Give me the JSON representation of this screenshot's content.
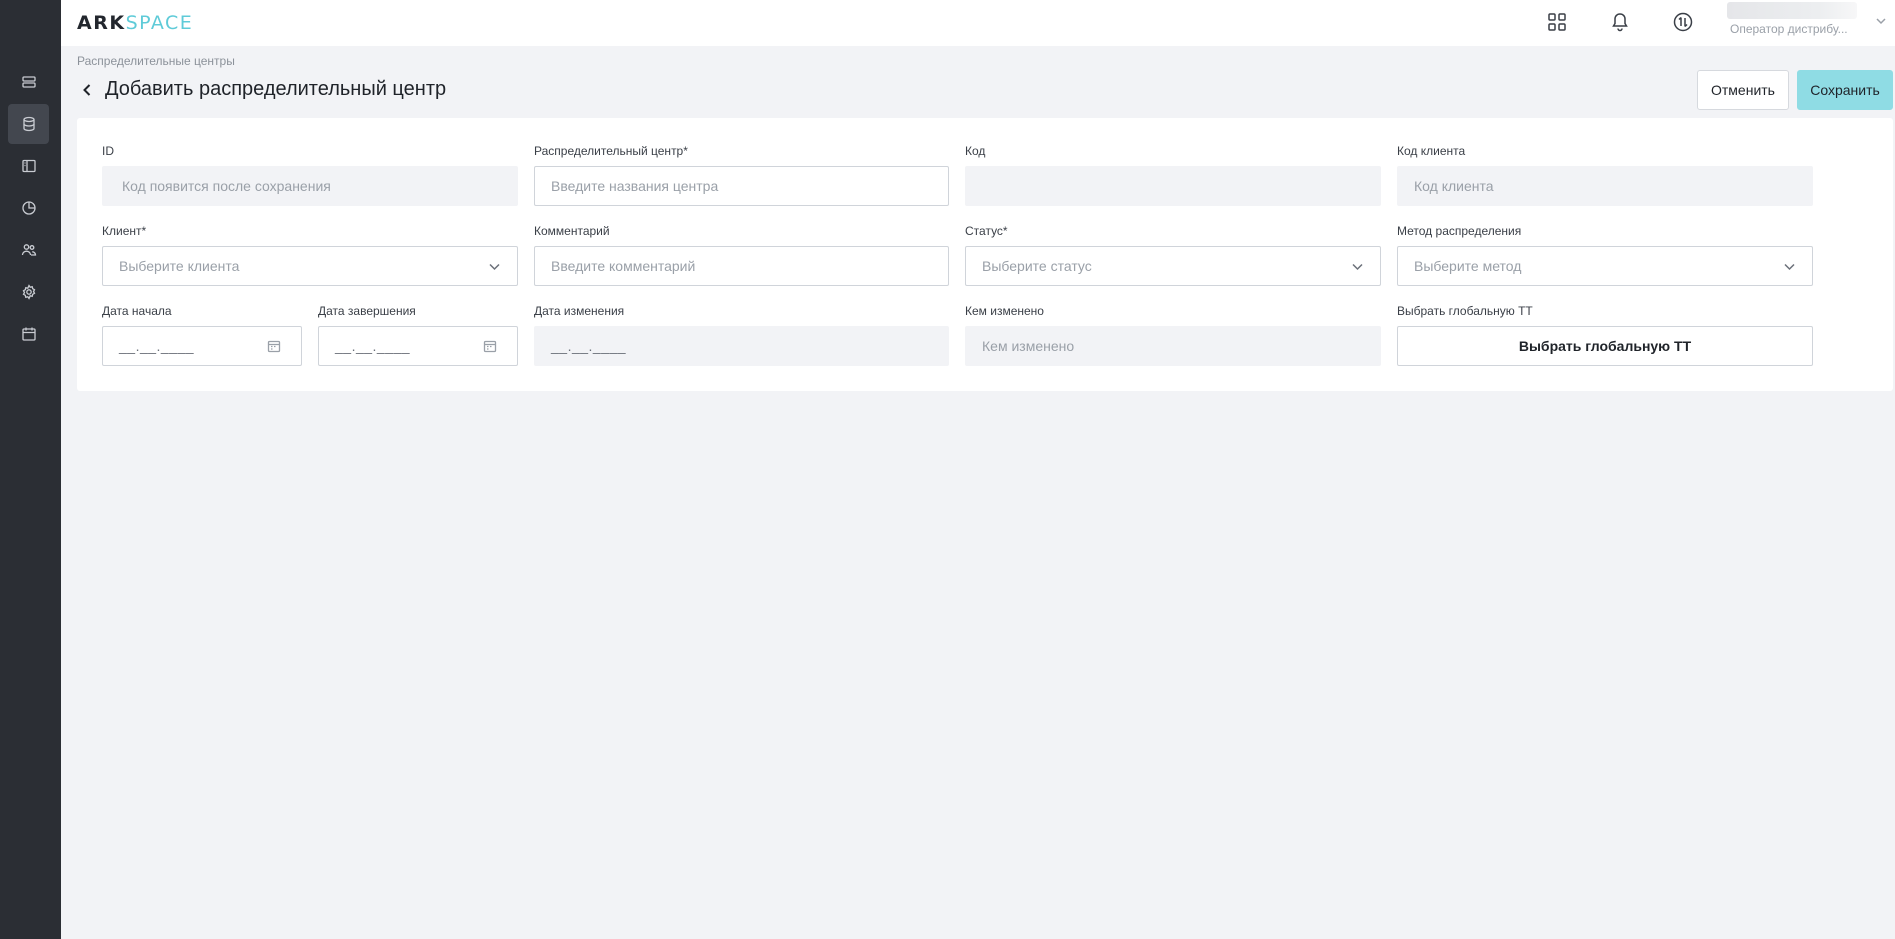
{
  "app": {
    "logo_ark": "ARK",
    "logo_space": "SPACE"
  },
  "user": {
    "role": "Оператор дистрибу..."
  },
  "breadcrumb": "Распределительные центры",
  "page_title": "Добавить распределительный центр",
  "actions": {
    "cancel_label": "Отменить",
    "save_label": "Сохранить"
  },
  "form": {
    "id": {
      "label": "ID",
      "placeholder": "Код появится после сохранения"
    },
    "center": {
      "label": "Распределительный центр*",
      "placeholder": "Введите названия центра"
    },
    "code": {
      "label": "Код",
      "value": ""
    },
    "client_code": {
      "label": "Код клиента",
      "placeholder": "Код клиента"
    },
    "client": {
      "label": "Клиент*",
      "placeholder": "Выберите клиента"
    },
    "comment": {
      "label": "Комментарий",
      "placeholder": "Введите комментарий"
    },
    "status": {
      "label": "Статус*",
      "placeholder": "Выберите статус"
    },
    "method": {
      "label": "Метод распределения",
      "placeholder": "Выберите метод"
    },
    "start_date": {
      "label": "Дата начала",
      "mask": "__.__.____"
    },
    "end_date": {
      "label": "Дата завершения",
      "mask": "__.__.____"
    },
    "modified_date": {
      "label": "Дата изменения",
      "mask": "__.__.____"
    },
    "modified_by": {
      "label": "Кем изменено",
      "placeholder": "Кем изменено"
    },
    "global_tt": {
      "label": "Выбрать глобальную ТТ",
      "button_label": "Выбрать глобальную ТТ"
    }
  },
  "icons": {
    "sidebar": [
      "list-icon",
      "database-icon",
      "layout-icon",
      "chart-pie-icon",
      "users-icon",
      "gear-icon",
      "calendar-icon"
    ],
    "topbar": [
      "apps-grid-icon",
      "bell-icon",
      "exchange-icon",
      "chevron-down-icon"
    ]
  },
  "colors": {
    "sidebar_bg": "#2b2e34",
    "accent": "#5fcbd8",
    "save_button": "#8fdce4",
    "page_bg": "#f2f3f6"
  }
}
